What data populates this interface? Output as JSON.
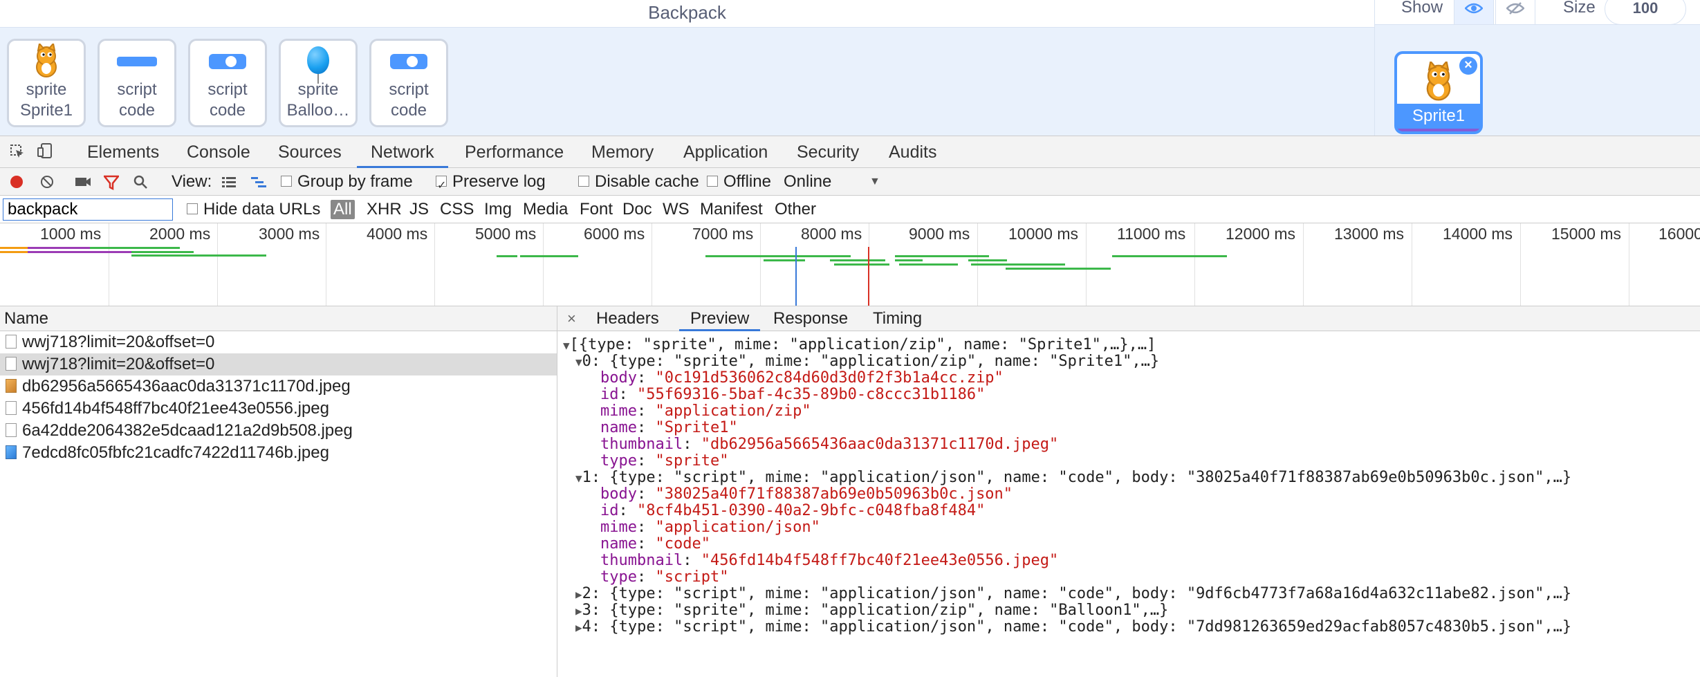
{
  "backpack": {
    "title": "Backpack",
    "items": [
      {
        "kind": "sprite",
        "name": "Sprite1",
        "thumb": "cat-icon"
      },
      {
        "kind": "script",
        "name": "code",
        "thumb": "block-icon"
      },
      {
        "kind": "script",
        "name": "code",
        "thumb": "block-icon"
      },
      {
        "kind": "sprite",
        "name": "Balloo…",
        "thumb": "balloon-icon"
      },
      {
        "kind": "script",
        "name": "code",
        "thumb": "block-icon"
      }
    ]
  },
  "stage_panel": {
    "show_label": "Show",
    "size_label": "Size",
    "size_value": "100",
    "sprite_name": "Sprite1"
  },
  "devtools": {
    "tabs": [
      "Elements",
      "Console",
      "Sources",
      "Network",
      "Performance",
      "Memory",
      "Application",
      "Security",
      "Audits"
    ],
    "active_tab": "Network",
    "toolbar": {
      "view_label": "View:",
      "group_by_frame": "Group by frame",
      "preserve_log": "Preserve log",
      "disable_cache": "Disable cache",
      "offline": "Offline",
      "throttle": "Online"
    },
    "filter": {
      "value": "backpack",
      "hide_data_urls": "Hide data URLs",
      "types": [
        "All",
        "XHR",
        "JS",
        "CSS",
        "Img",
        "Media",
        "Font",
        "Doc",
        "WS",
        "Manifest",
        "Other"
      ]
    },
    "timeline_ticks": [
      "1000 ms",
      "2000 ms",
      "3000 ms",
      "4000 ms",
      "5000 ms",
      "6000 ms",
      "7000 ms",
      "8000 ms",
      "9000 ms",
      "10000 ms",
      "11000 ms",
      "12000 ms",
      "13000 ms",
      "14000 ms",
      "15000 ms",
      "16000"
    ],
    "name_header": "Name",
    "requests": [
      "wwj718?limit=20&offset=0",
      "wwj718?limit=20&offset=0",
      "db62956a5665436aac0da31371c1170d.jpeg",
      "456fd14b4f548ff7bc40f21ee43e0556.jpeg",
      "6a42dde2064382e5dcaad121a2d9b508.jpeg",
      "7edcd8fc05fbfc21cadfc7422d11746b.jpeg"
    ],
    "detail_tabs": [
      "Headers",
      "Preview",
      "Response",
      "Timing"
    ],
    "detail_close": "×",
    "preview": {
      "root": "[{type: \"sprite\", mime: \"application/zip\", name: \"Sprite1\",…},…]",
      "item0_summary": "0: {type: \"sprite\", mime: \"application/zip\", name: \"Sprite1\",…}",
      "item0": [
        [
          "body",
          "\"0c191d536062c84d60d3d0f2f3b1a4cc.zip\""
        ],
        [
          "id",
          "\"55f69316-5baf-4c35-89b0-c8ccc31b1186\""
        ],
        [
          "mime",
          "\"application/zip\""
        ],
        [
          "name",
          "\"Sprite1\""
        ],
        [
          "thumbnail",
          "\"db62956a5665436aac0da31371c1170d.jpeg\""
        ],
        [
          "type",
          "\"sprite\""
        ]
      ],
      "item1_summary": "1: {type: \"script\", mime: \"application/json\", name: \"code\", body: \"38025a40f71f88387ab69e0b50963b0c.json\",…}",
      "item1": [
        [
          "body",
          "\"38025a40f71f88387ab69e0b50963b0c.json\""
        ],
        [
          "id",
          "\"8cf4b451-0390-40a2-9bfc-c048fba8f484\""
        ],
        [
          "mime",
          "\"application/json\""
        ],
        [
          "name",
          "\"code\""
        ],
        [
          "thumbnail",
          "\"456fd14b4f548ff7bc40f21ee43e0556.jpeg\""
        ],
        [
          "type",
          "\"script\""
        ]
      ],
      "item2_summary": "2: {type: \"script\", mime: \"application/json\", name: \"code\", body: \"9df6cb4773f7a68a16d4a632c11abe82.json\",…}",
      "item3_summary": "3: {type: \"sprite\", mime: \"application/zip\", name: \"Balloon1\",…}",
      "item4_summary": "4: {type: \"script\", mime: \"application/json\", name: \"code\", body: \"7dd981263659ed29acfab8057c4830b5.json\",…}"
    }
  },
  "colors": {
    "scratch_blue": "#4c97ff",
    "scratch_purple": "#855cd6",
    "devtools_accent": "#3879d9",
    "record_red": "#d93025",
    "timeline_green": "#3cb84a"
  }
}
